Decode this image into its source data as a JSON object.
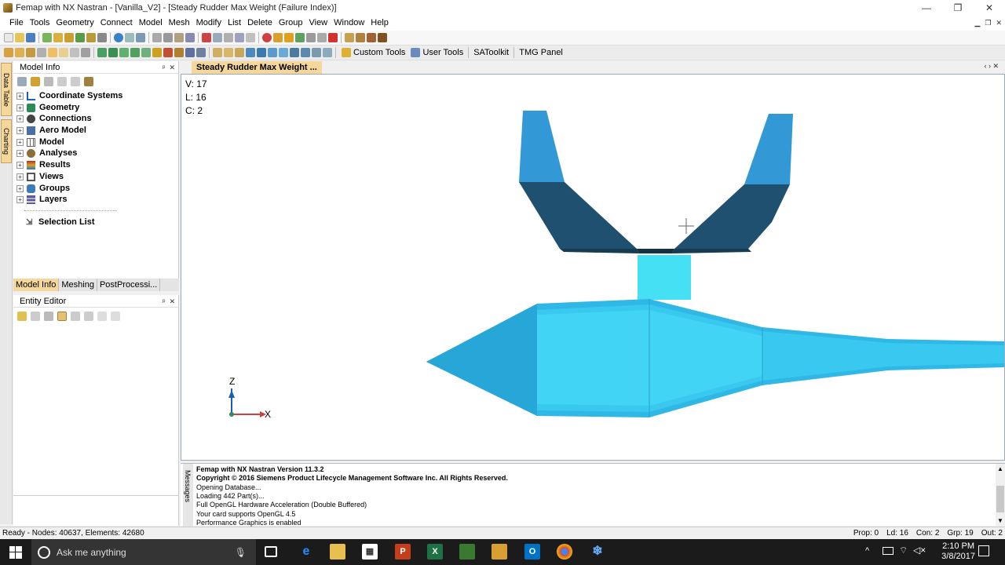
{
  "window": {
    "title": "Femap with NX Nastran - [Vanilla_V2] - [Steady Rudder Max Weight (Failure Index)]",
    "minimize": "—",
    "maximize": "❐",
    "close": "✕"
  },
  "menu": [
    "File",
    "Tools",
    "Geometry",
    "Connect",
    "Model",
    "Mesh",
    "Modify",
    "List",
    "Delete",
    "Group",
    "View",
    "Window",
    "Help"
  ],
  "toolbar2_buttons": {
    "custom_tools": "Custom Tools",
    "user_tools": "User Tools",
    "satoolkit": "SAToolkit",
    "tmg_panel": "TMG Panel"
  },
  "left_dock": {
    "data_table_tab": "Data Table",
    "charting_tab": "Charting"
  },
  "model_info": {
    "title": "Model Info",
    "tree": [
      {
        "label": "Coordinate Systems",
        "icon": "coord-sys-icon",
        "color": "#1a5fb4"
      },
      {
        "label": "Geometry",
        "icon": "geometry-icon",
        "color": "#2e8b57"
      },
      {
        "label": "Connections",
        "icon": "connections-icon",
        "color": "#444444"
      },
      {
        "label": "Aero Model",
        "icon": "aero-icon",
        "color": "#4a6fa5"
      },
      {
        "label": "Model",
        "icon": "model-icon",
        "color": "#666666"
      },
      {
        "label": "Analyses",
        "icon": "analyses-icon",
        "color": "#8a6d3b"
      },
      {
        "label": "Results",
        "icon": "results-icon",
        "color": "#b03030"
      },
      {
        "label": "Views",
        "icon": "views-icon",
        "color": "#555555"
      },
      {
        "label": "Groups",
        "icon": "groups-icon",
        "color": "#3c7ab8"
      },
      {
        "label": "Layers",
        "icon": "layers-icon",
        "color": "#5a5a9a"
      }
    ],
    "selection_list": "Selection List"
  },
  "bottom_tabs": [
    "Model Info",
    "Meshing",
    "PostProcessi..."
  ],
  "entity_editor": {
    "title": "Entity Editor"
  },
  "graphics": {
    "tab_title": "Steady Rudder Max Weight ...",
    "stats": [
      "V: 17",
      "L: 16",
      "C: 2"
    ],
    "axis_z": "Z",
    "axis_x": "X"
  },
  "messages": {
    "label": "Messages",
    "lines": [
      {
        "text": "Femap with NX Nastran Version 11.3.2",
        "bold": true
      },
      {
        "text": "Copyright © 2016 Siemens Product Lifecycle Management Software Inc. All Rights Reserved.",
        "bold": true
      },
      {
        "text": "Opening Database...",
        "bold": false
      },
      {
        "text": "Loading 442 Part(s)...",
        "bold": false
      },
      {
        "text": "Full OpenGL Hardware Acceleration (Double Buffered)",
        "bold": false
      },
      {
        "text": "Your card supports OpenGL 4.5",
        "bold": false
      },
      {
        "text": "Performance Graphics is enabled",
        "bold": false
      }
    ]
  },
  "status": {
    "left": "Ready - Nodes: 40637,  Elements: 42680",
    "prop": "Prop: 0",
    "ld": "Ld: 16",
    "con": "Con: 2",
    "grp": "Grp: 19",
    "out": "Out: 2"
  },
  "taskbar": {
    "search_placeholder": "Ask me anything",
    "time": "2:10 PM",
    "date": "3/8/2017"
  },
  "colors": {
    "accent_tab": "#f6d79b",
    "model_light": "#3399d6",
    "model_dark": "#1e4f6e",
    "model_cyan": "#46e0f5"
  }
}
